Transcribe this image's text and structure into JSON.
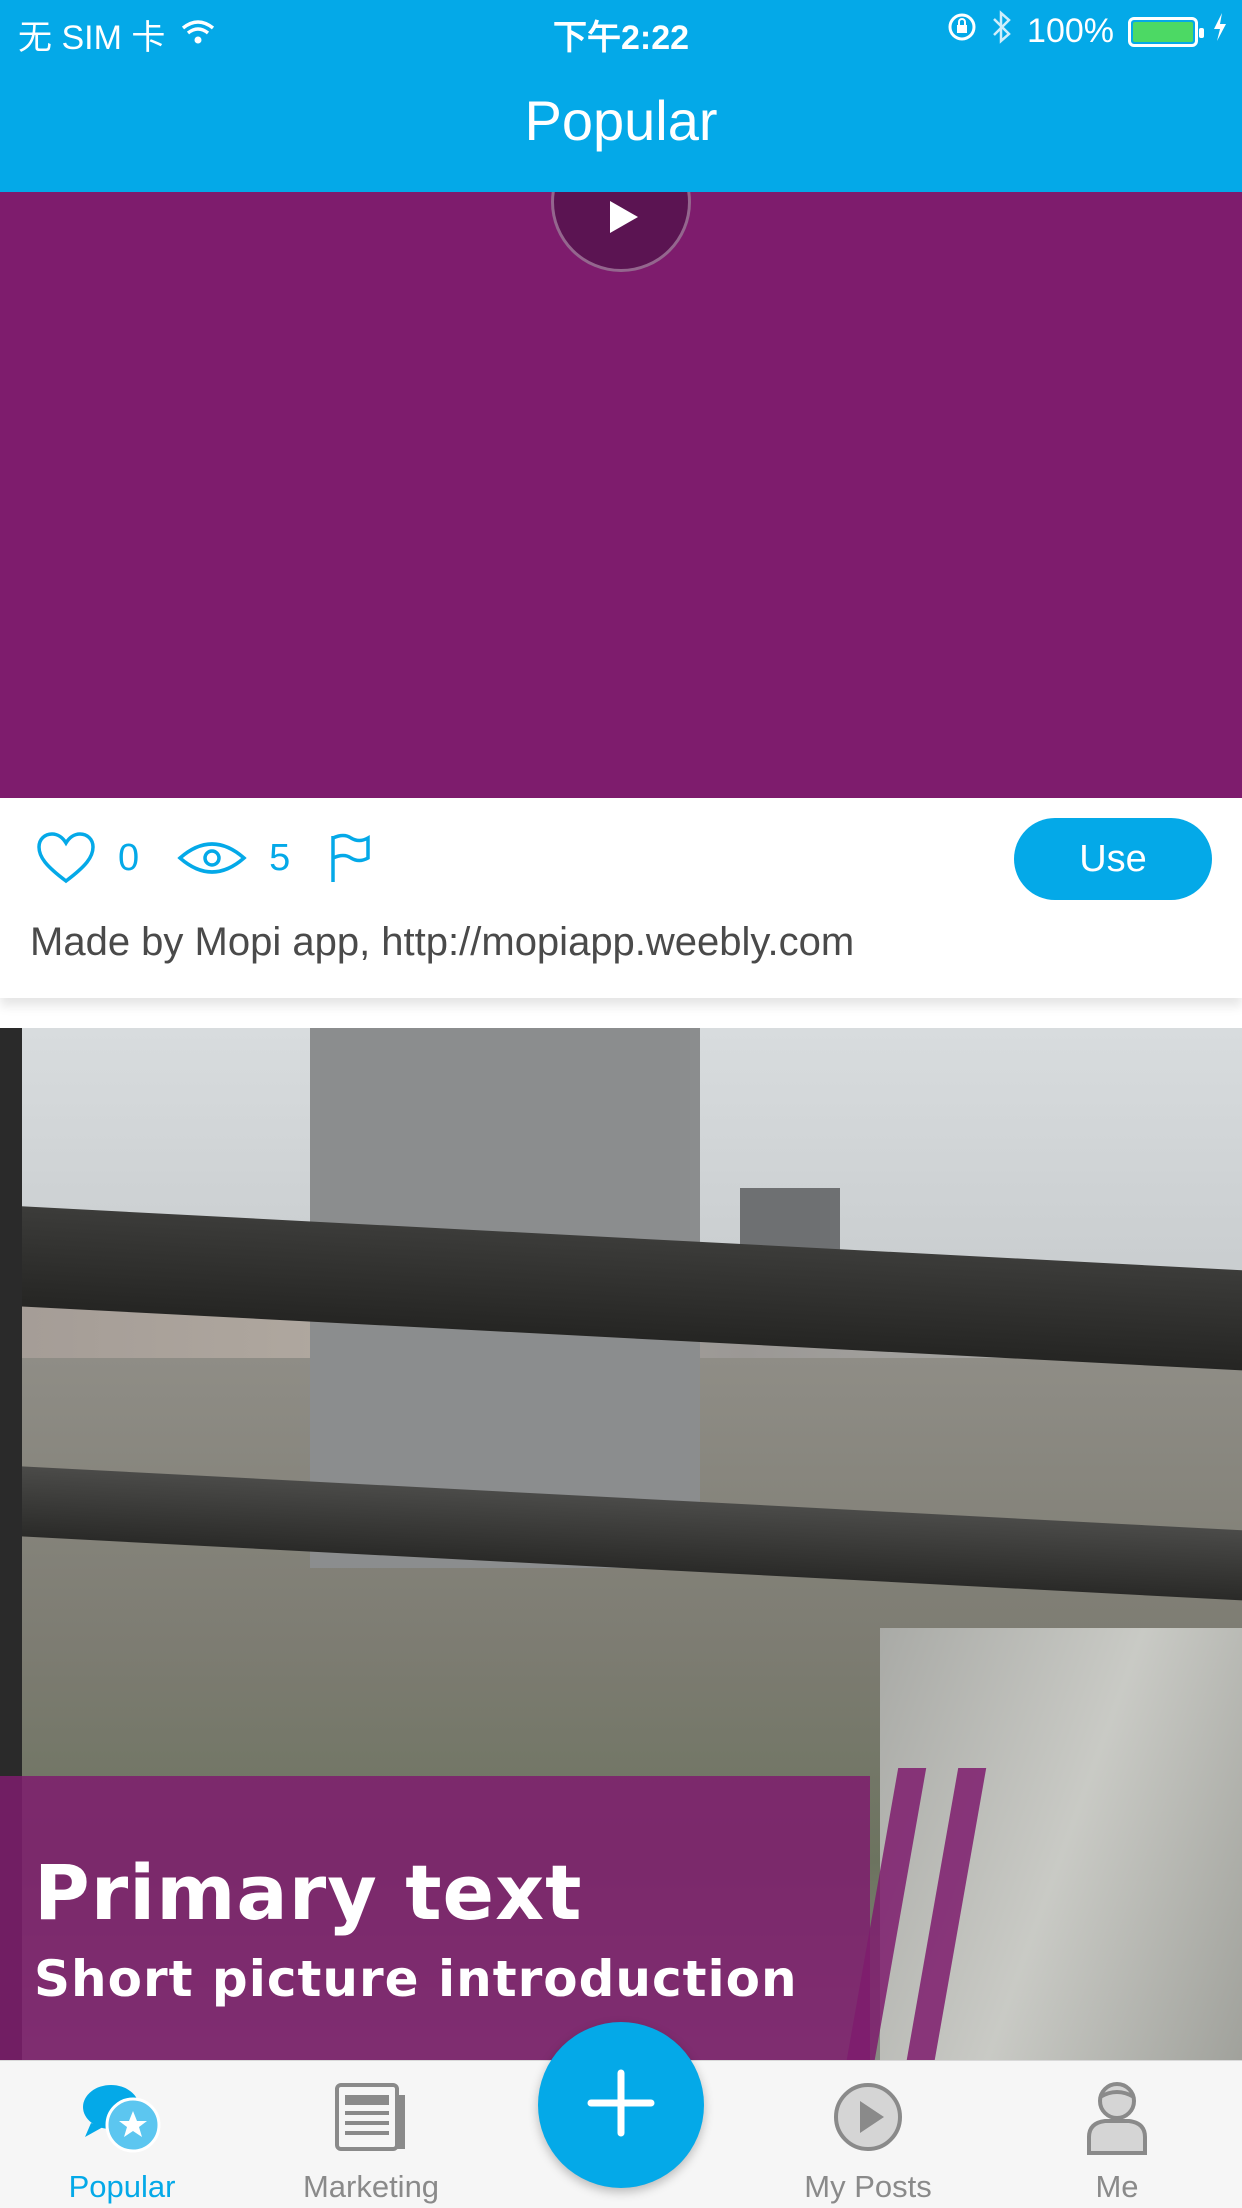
{
  "status_bar": {
    "carrier": "无 SIM 卡",
    "time": "下午2:22",
    "battery": "100%"
  },
  "nav": {
    "title": "Popular"
  },
  "posts": [
    {
      "likes": "0",
      "views": "5",
      "use_label": "Use",
      "caption": "Made by Mopi app, http://mopiapp.weebly.com"
    },
    {
      "primary_text": "Primary text",
      "intro_text": "Short picture introduction"
    }
  ],
  "tabs": [
    {
      "label": "Popular",
      "icon": "chat-star-icon",
      "active": true
    },
    {
      "label": "Marketing",
      "icon": "newspaper-icon",
      "active": false
    },
    {
      "label": "My Posts",
      "icon": "play-circle-icon",
      "active": false
    },
    {
      "label": "Me",
      "icon": "person-icon",
      "active": false
    }
  ],
  "colors": {
    "accent": "#04a9e8",
    "video_bg": "#7e1c6d",
    "tab_inactive": "#8a8a8a"
  }
}
